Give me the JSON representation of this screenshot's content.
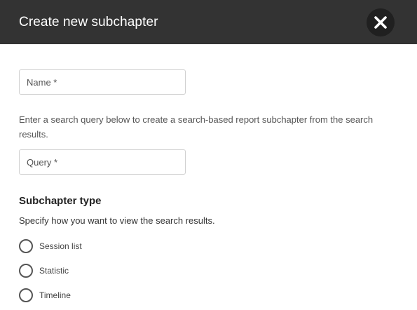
{
  "dialog": {
    "title": "Create new subchapter",
    "close_icon": "close-icon"
  },
  "form": {
    "name_placeholder": "Name *",
    "name_value": "",
    "description": "Enter a search query below to create a search-based report subchapter from the search results.",
    "query_placeholder": "Query *",
    "query_value": ""
  },
  "subchapter_type": {
    "heading": "Subchapter type",
    "help": "Specify how you want to view the search results.",
    "options": [
      {
        "label": "Session list",
        "selected": false
      },
      {
        "label": "Statistic",
        "selected": false
      },
      {
        "label": "Timeline",
        "selected": false
      }
    ]
  },
  "colors": {
    "header_bg": "#333333",
    "close_bg": "#202020",
    "text": "#333333"
  }
}
